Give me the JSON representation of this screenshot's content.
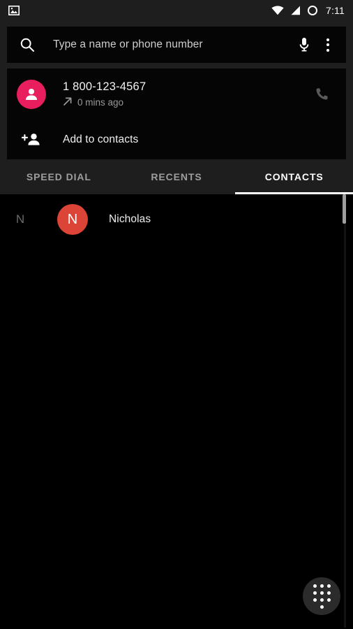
{
  "status_bar": {
    "left_icon": "image-icon",
    "icons": [
      "wifi-icon",
      "cellular-signal-icon",
      "battery-circle-icon"
    ],
    "clock": "7:11"
  },
  "search": {
    "placeholder": "Type a name or phone number",
    "value": "",
    "search_icon": "search-icon",
    "mic_icon": "microphone-icon",
    "overflow_icon": "overflow-menu-icon"
  },
  "call_card": {
    "avatar_icon": "person-icon",
    "avatar_color": "#e91e5f",
    "number": "1 800-123-4567",
    "direction_icon": "outgoing-call-arrow-icon",
    "time": "0 mins ago",
    "call_icon": "phone-call-icon",
    "add_icon": "person-add-icon",
    "add_label": "Add to contacts"
  },
  "tabs": [
    {
      "label": "SPEED DIAL",
      "active": false
    },
    {
      "label": "RECENTS",
      "active": false
    },
    {
      "label": "CONTACTS",
      "active": true
    }
  ],
  "contacts": {
    "sections": [
      {
        "letter": "N",
        "items": [
          {
            "initial": "N",
            "name": "Nicholas",
            "avatar_color": "#db4437"
          }
        ]
      }
    ]
  },
  "fab": {
    "icon": "dialpad-icon",
    "color": "#2b2b2b"
  }
}
